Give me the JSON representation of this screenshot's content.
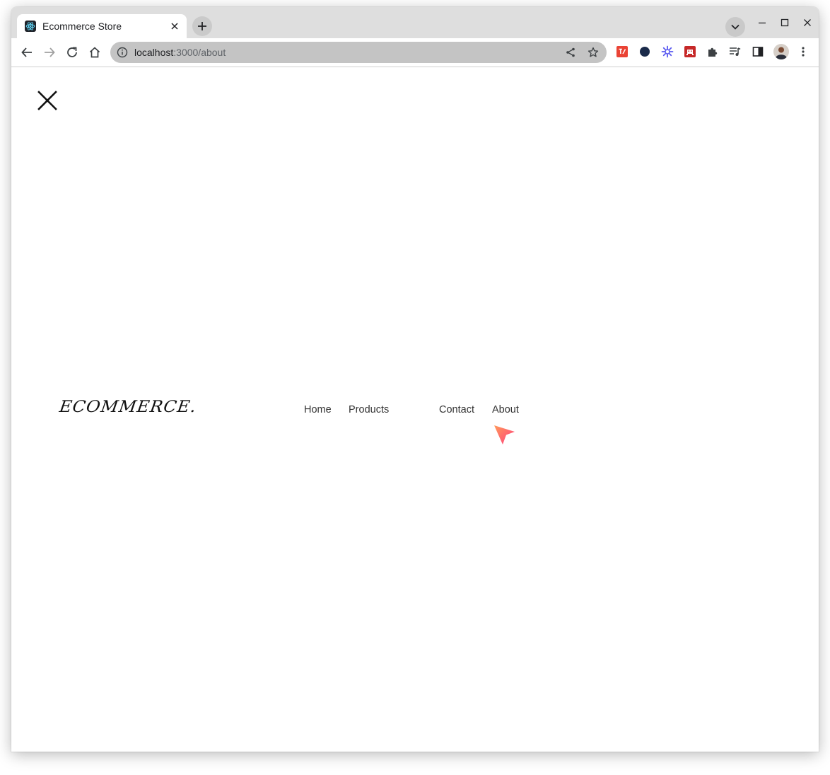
{
  "browser": {
    "tab": {
      "title": "Ecommerce Store",
      "favicon": "react-atom-icon"
    },
    "address_bar": {
      "host": "localhost",
      "path": ":3000/about"
    },
    "extensions": [
      "translate-icon",
      "eclipse-icon",
      "asterisk-icon",
      "invader-icon",
      "puzzle-icon",
      "media-queue-icon",
      "side-panel-icon",
      "profile-avatar",
      "more-icon"
    ]
  },
  "page": {
    "brand": "ECOMMERCE.",
    "nav": {
      "home": "Home",
      "products": "Products",
      "contact": "Contact",
      "about": "About"
    },
    "accent_gradient": [
      "#ff9a5a",
      "#ff3d7f"
    ]
  }
}
